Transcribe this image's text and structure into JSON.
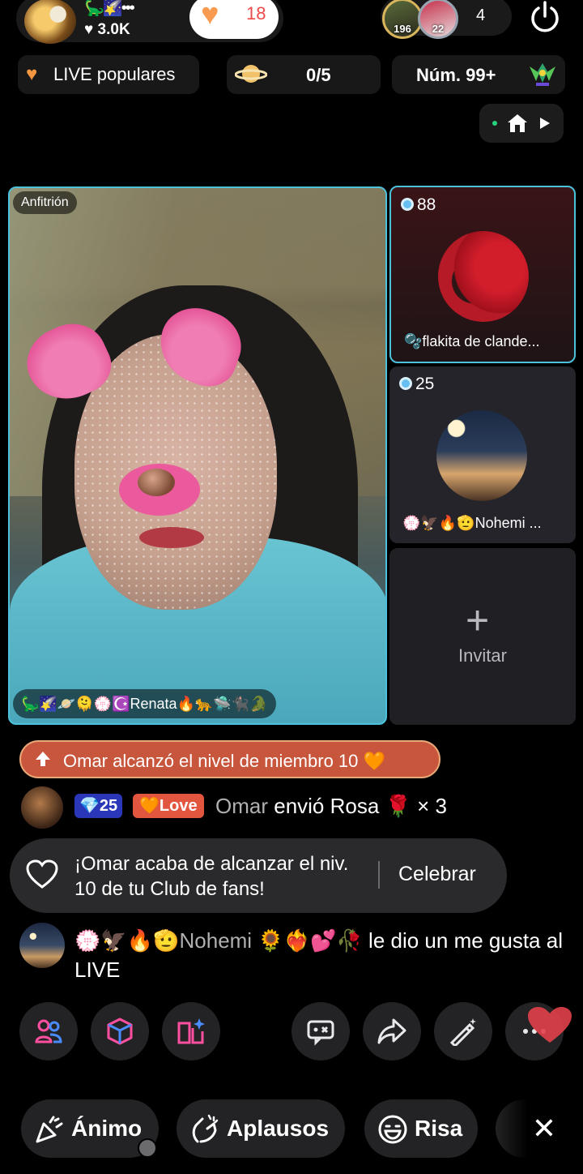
{
  "header": {
    "host_badges": "🦕🌠•••",
    "host_likes": "♥ 3.0K",
    "heart_count": "18",
    "viewer_badges": [
      "196",
      "22"
    ],
    "viewer_count": "4"
  },
  "row2": {
    "live_popular": "LIVE populares",
    "planet_progress": "0/5",
    "rank": "Núm. 99+"
  },
  "host_video": {
    "tag": "Anfitrión",
    "name": "🦕🌠🪐🫠💮☪️Renata🔥🐆🛸🐈‍⬛🐊"
  },
  "guests": [
    {
      "score": "88",
      "name": "🫧flakita de clande..."
    },
    {
      "score": "25",
      "name": "💮🦅🔥🫡Nohemi ..."
    },
    {
      "invite_label": "Invitar"
    }
  ],
  "chat": {
    "member_banner": "Omar alcanzó el nivel de miembro 10 🧡",
    "gift": {
      "level": "25",
      "love_badge": "Love",
      "user": "Omar",
      "action": "envió Rosa 🌹 × 3"
    },
    "fan_toast": {
      "message": "¡Omar acaba de alcanzar el niv. 10 de tu Club de fans!",
      "button": "Celebrar"
    },
    "like": {
      "user": "💮🦅🔥🫡Nohemi 🌻❤️‍🔥💕🥀",
      "action": "le dio un me gusta al LIVE"
    }
  },
  "tools": [
    "people-icon",
    "cube-icon",
    "book-sparkle-icon",
    "gamepad-icon",
    "share-icon",
    "magic-wand-icon",
    "more-icon"
  ],
  "reactions": {
    "cheer": "Ánimo",
    "applause": "Aplausos",
    "laugh": "Risa"
  },
  "colors": {
    "accent_cyan": "#4cc1db",
    "heart_orange": "#f89a4f",
    "banner_red": "#c8563c",
    "level_blue": "#2a37b8",
    "love_red": "#e2553e"
  }
}
